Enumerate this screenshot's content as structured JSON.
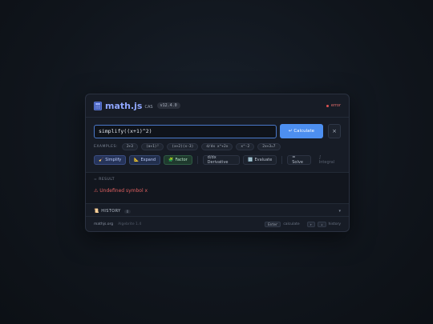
{
  "header": {
    "title": "math.js",
    "subtitle": "CAS",
    "version": "v12.4.0",
    "status": "error",
    "status_color": "#e05252"
  },
  "input": {
    "value": "simplify((x+1)^2)",
    "calculate_label": "↵ Calculate",
    "clear_label": "×"
  },
  "examples": {
    "label": "EXAMPLES:",
    "items": [
      "2+3",
      "(a+1)²",
      "(x+2)(x-3)",
      "d/dx x^+2x",
      "x^-2",
      "2x+3=7"
    ]
  },
  "operations": [
    {
      "label": "Simplify",
      "icon": "broom-icon"
    },
    {
      "label": "Expand",
      "icon": "chart-icon"
    },
    {
      "label": "Factor",
      "icon": "puzzle-icon"
    },
    {
      "label": "d/dx Derivative",
      "icon": ""
    },
    {
      "label": "Evaluate",
      "icon": "calculator-icon"
    },
    {
      "label": "= Solve",
      "icon": ""
    },
    {
      "label": "∫ Integral",
      "icon": ""
    }
  ],
  "result": {
    "label": "= RESULT",
    "error": "⚠ Undefined symbol x"
  },
  "history": {
    "title": "HISTORY",
    "count": "0",
    "chevron": "▾"
  },
  "footer": {
    "library": "mathjs.org",
    "engine": "Algebrite 1.4",
    "enter_key": "Enter",
    "enter_label": "calculate",
    "up_key": "↑",
    "down_key": "↓",
    "history_label": "history"
  },
  "colors": {
    "accent": "#4d8ff0",
    "error": "#e06060"
  }
}
